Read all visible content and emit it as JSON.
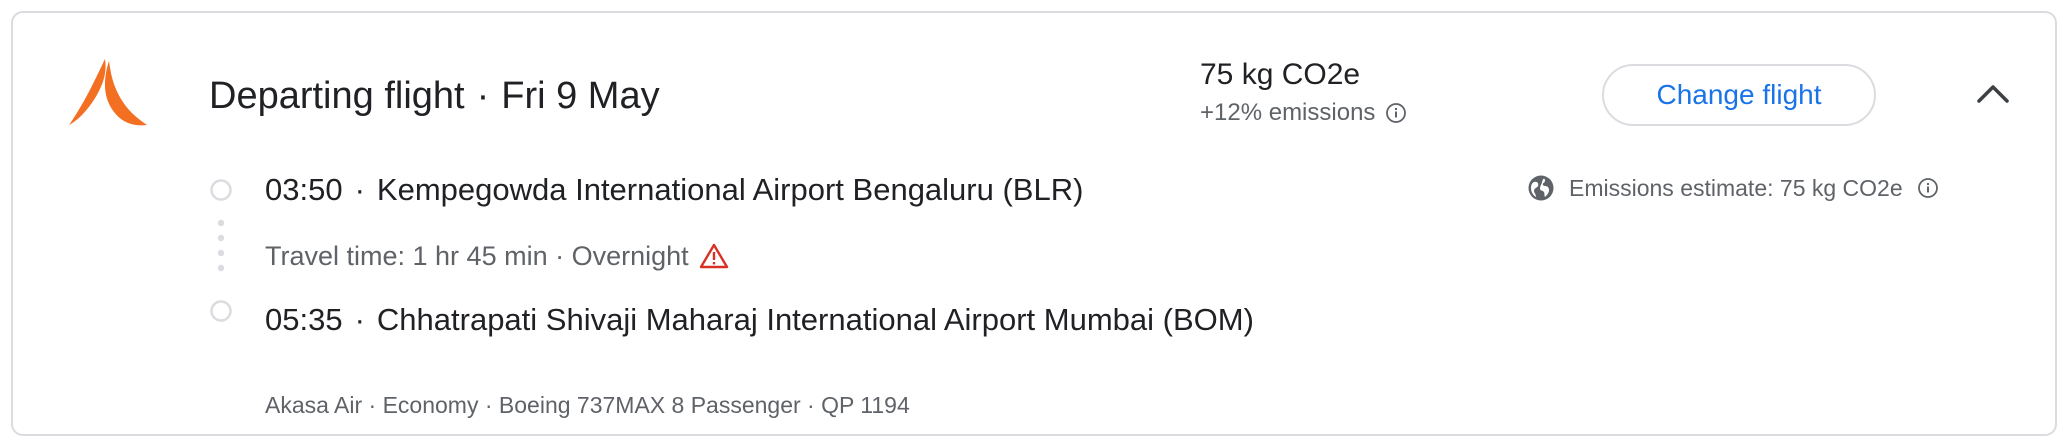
{
  "flight": {
    "title": "Departing flight",
    "date": "Fri 9 May",
    "separator": "·",
    "airline_logo": "akasa-air-logo",
    "brand_color": "#f36f21"
  },
  "emissions": {
    "value": "75 kg CO2e",
    "delta": "+12% emissions",
    "estimate": "Emissions estimate: 75 kg CO2e"
  },
  "actions": {
    "change_label": "Change flight",
    "collapse_icon": "chevron-up-icon",
    "accent_color": "#1a73e8"
  },
  "departure": {
    "time": "03:50",
    "airport": "Kempegowda International Airport Bengaluru (BLR)"
  },
  "travel": {
    "text": "Travel time: 1 hr 45 min · Overnight",
    "warning_icon": "warning-icon",
    "warning_color": "#d93025"
  },
  "arrival": {
    "time": "05:35",
    "airport": "Chhatrapati Shivaji Maharaj International Airport Mumbai (BOM)"
  },
  "details": {
    "text": "Akasa Air · Economy · Boeing 737MAX 8 Passenger · QP 1194"
  }
}
